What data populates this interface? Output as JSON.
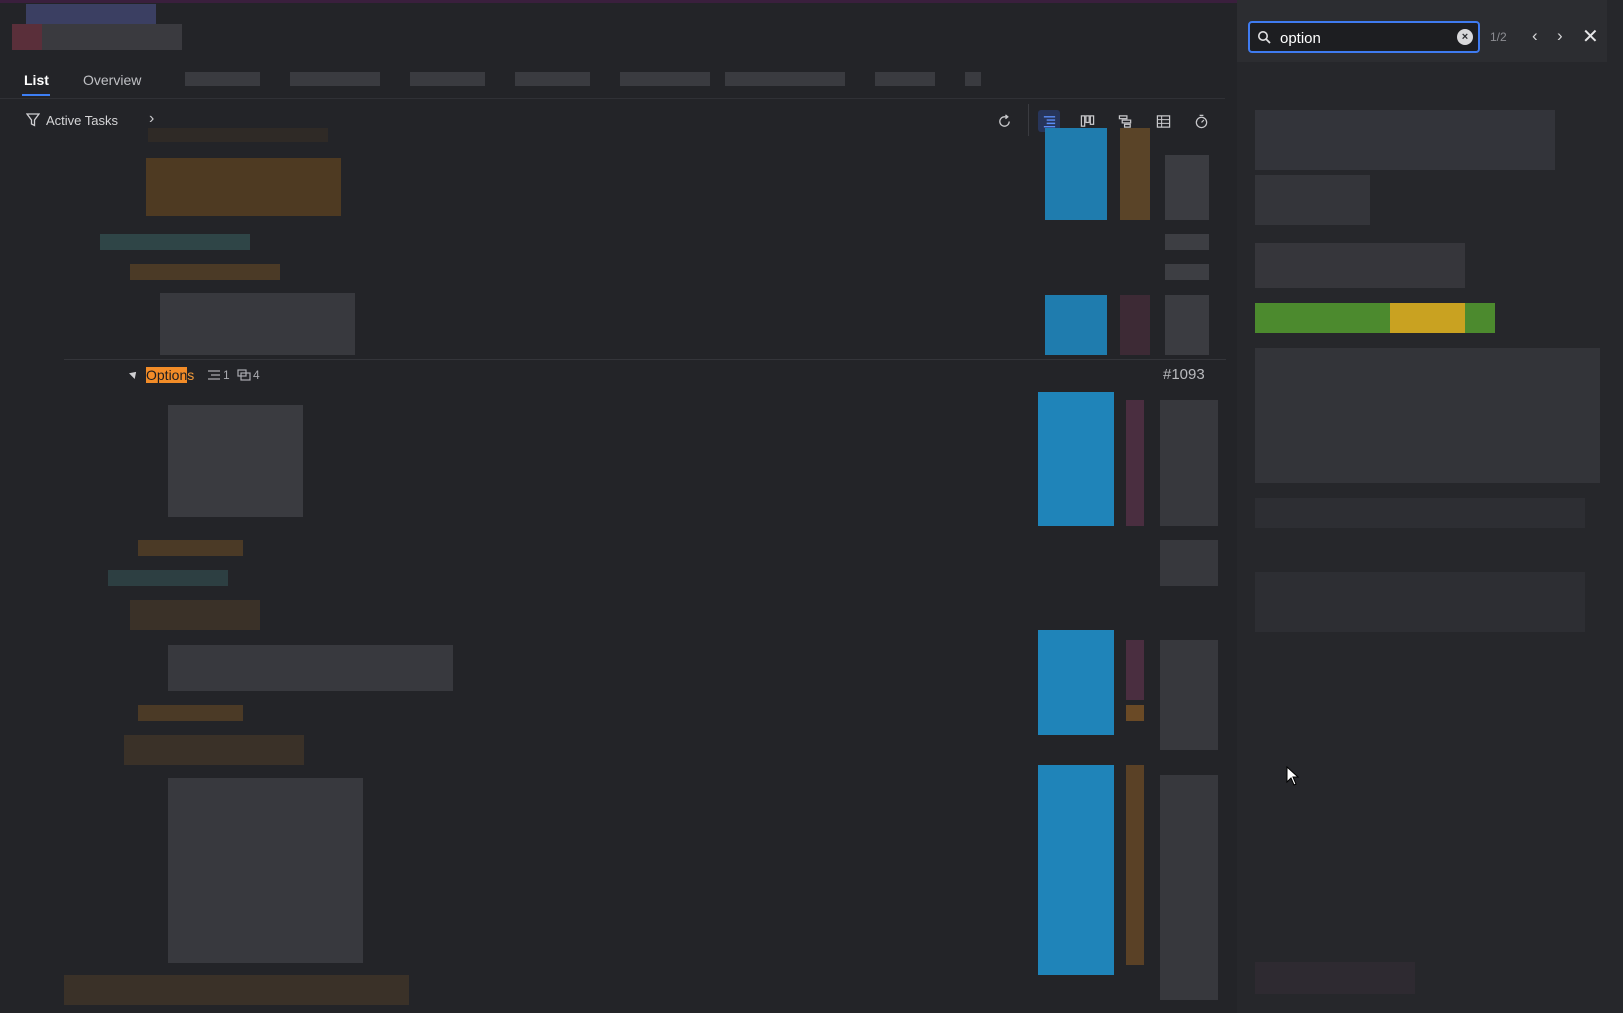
{
  "tabs": [
    {
      "label": "List",
      "active": true
    },
    {
      "label": "Overview",
      "active": false
    }
  ],
  "filter": {
    "label": "Active Tasks"
  },
  "toolbar": {
    "icons": [
      "refresh-icon",
      "list-view-icon",
      "board-view-icon",
      "gantt-view-icon",
      "table-view-icon",
      "timer-icon"
    ],
    "active": "list-view-icon"
  },
  "group": {
    "name_match": "Option",
    "name_rest": "s",
    "subtask_count": "1",
    "attachment_count": "4",
    "id": "#1093"
  },
  "search": {
    "value": "option",
    "count": "1/2"
  },
  "colors": {
    "accent": "#3d7ff5",
    "highlight": "#f28c28",
    "background": "#232428"
  }
}
